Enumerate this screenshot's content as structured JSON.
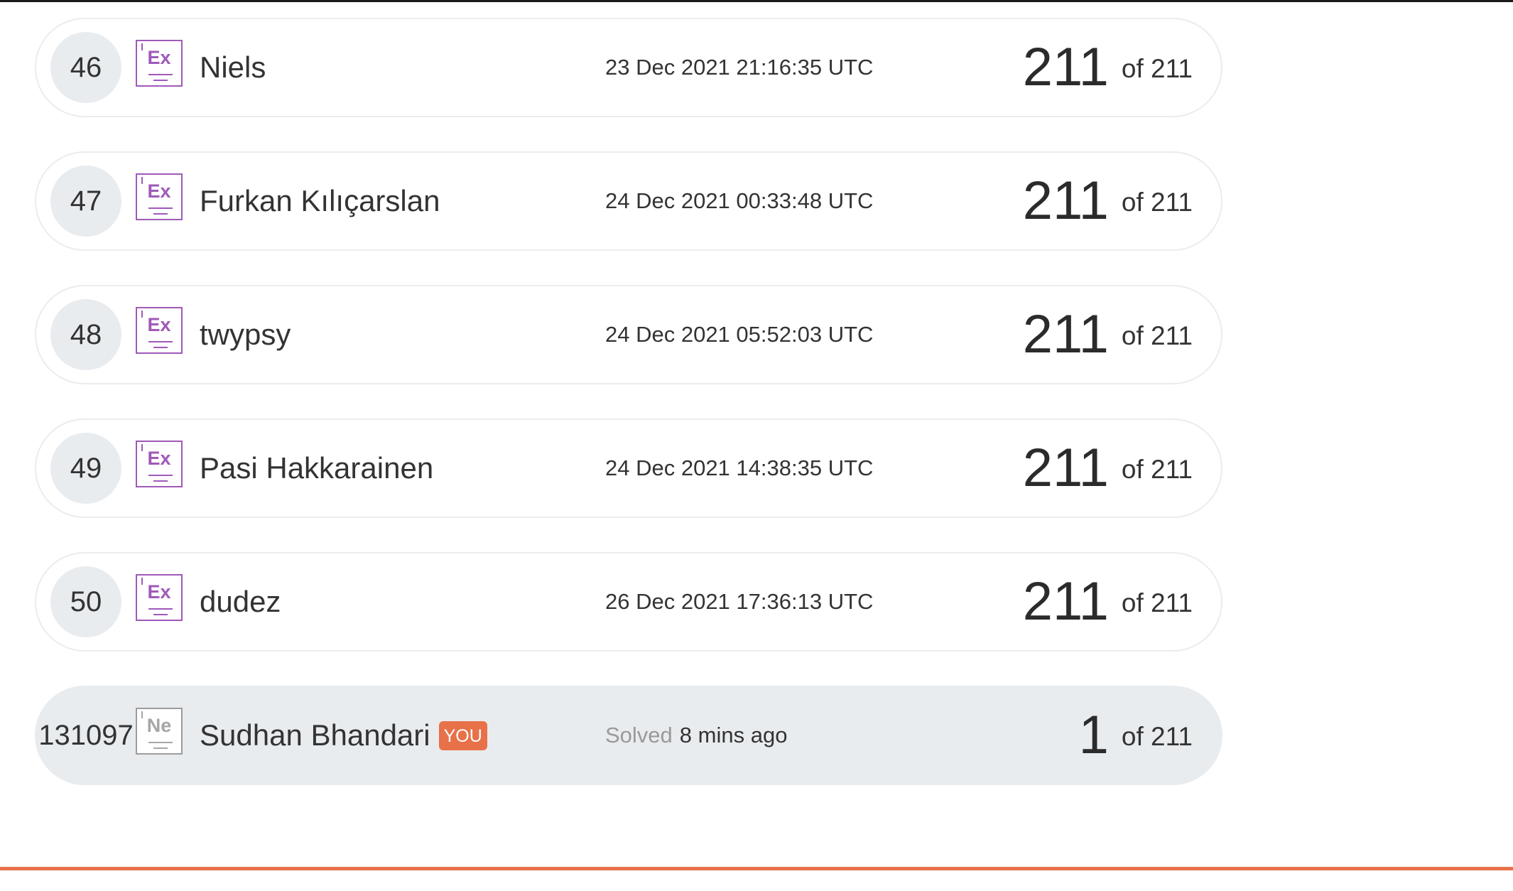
{
  "leaderboard": {
    "rows": [
      {
        "rank": "46",
        "badge": "Ex",
        "name": "Niels",
        "date": "23 Dec 2021 21:16:35 UTC",
        "score": "211",
        "total": "of 211"
      },
      {
        "rank": "47",
        "badge": "Ex",
        "name": "Furkan Kılıçarslan",
        "date": "24 Dec 2021 00:33:48 UTC",
        "score": "211",
        "total": "of 211"
      },
      {
        "rank": "48",
        "badge": "Ex",
        "name": "twypsy",
        "date": "24 Dec 2021 05:52:03 UTC",
        "score": "211",
        "total": "of 211"
      },
      {
        "rank": "49",
        "badge": "Ex",
        "name": "Pasi Hakkarainen",
        "date": "24 Dec 2021 14:38:35 UTC",
        "score": "211",
        "total": "of 211"
      },
      {
        "rank": "50",
        "badge": "Ex",
        "name": "dudez",
        "date": "26 Dec 2021 17:36:13 UTC",
        "score": "211",
        "total": "of 211"
      }
    ],
    "current_user": {
      "rank": "131097",
      "badge": "Ne",
      "name": "Sudhan Bhandari",
      "you_label": "YOU",
      "solved_label": "Solved",
      "solved_time": "8 mins ago",
      "score": "1",
      "total": "of 211"
    }
  },
  "colors": {
    "accent": "#e8714a",
    "expert_badge": "#a05ab8",
    "newbie_badge": "#a6a6a6",
    "row_highlight": "#e9ecef"
  }
}
